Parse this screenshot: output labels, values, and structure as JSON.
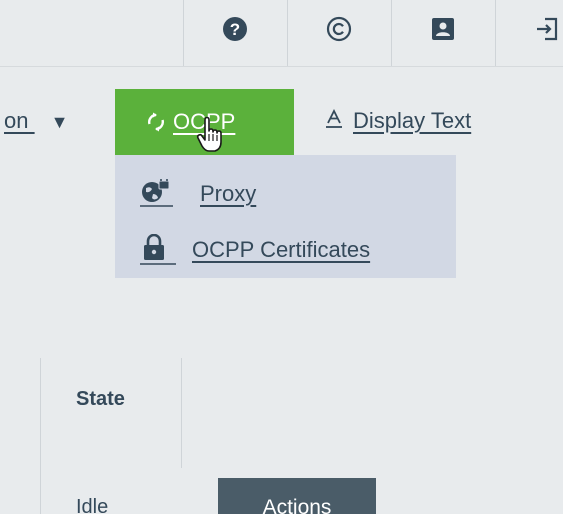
{
  "topbar": {
    "icons": [
      "help-icon",
      "copyright-icon",
      "contact-card-icon",
      "logout-icon"
    ],
    "help_glyph": "?",
    "copyright_glyph": "©"
  },
  "menu": {
    "partial_item_label": "on",
    "partial_item_caret": "▼",
    "ocpp_label": "OCPP",
    "ocpp_icon": "sync-icon",
    "ocpp_color": "#5bb13b",
    "display_text_label": "Display Text",
    "display_text_icon": "text-format-icon"
  },
  "dropdown": {
    "background": "#d2d8e4",
    "items": [
      {
        "label": "Proxy",
        "icon": "globe-lock-icon"
      },
      {
        "label": "OCPP Certificates",
        "icon": "lock-icon"
      }
    ]
  },
  "table": {
    "state_header": "State",
    "rows": [
      {
        "state": "Idle",
        "action_label": "Actions"
      }
    ]
  }
}
